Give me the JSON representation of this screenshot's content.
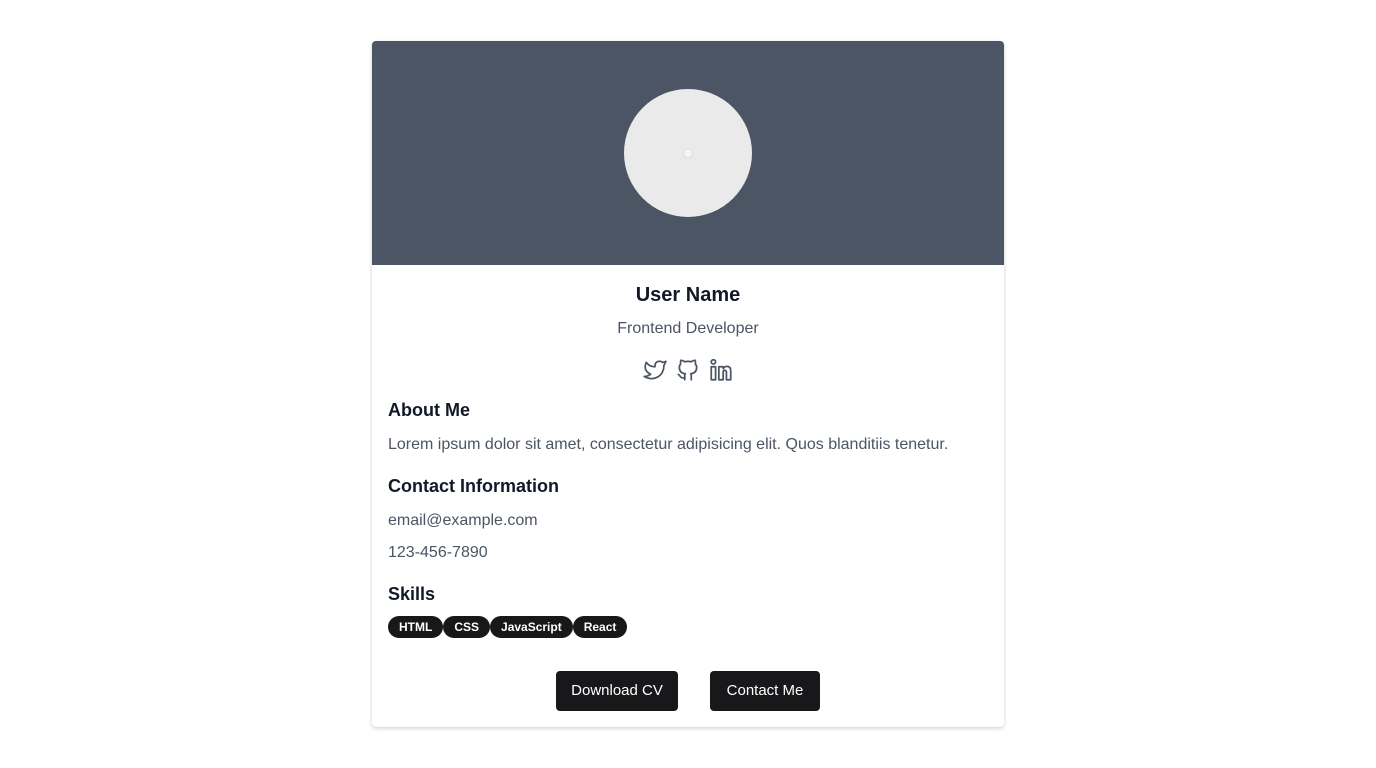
{
  "profile": {
    "name": "User Name",
    "role": "Frontend Developer"
  },
  "social": {
    "icons": [
      "twitter-icon",
      "github-icon",
      "linkedin-icon"
    ]
  },
  "about": {
    "heading": "About Me",
    "text": "Lorem ipsum dolor sit amet, consectetur adipisicing elit. Quos blanditiis tenetur."
  },
  "contact": {
    "heading": "Contact Information",
    "email": "email@example.com",
    "phone": "123-456-7890"
  },
  "skills": {
    "heading": "Skills",
    "items": [
      "HTML",
      "CSS",
      "JavaScript",
      "React"
    ]
  },
  "actions": {
    "download_label": "Download CV",
    "contact_label": "Contact Me"
  },
  "colors": {
    "banner": "#4b5563",
    "text_primary": "#111827",
    "text_secondary": "#4b5563",
    "button_bg": "#18181b",
    "avatar_bg": "#eaeaea"
  }
}
